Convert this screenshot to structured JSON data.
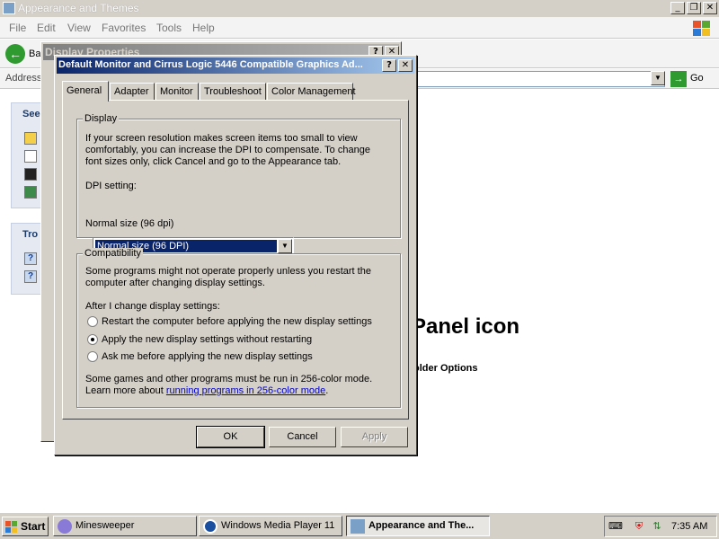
{
  "explorer": {
    "title": "Appearance and Themes",
    "menu": [
      "File",
      "Edit",
      "View",
      "Favorites",
      "Tools",
      "Help"
    ],
    "back_label": "Ba",
    "address_label": "Address",
    "go_label": "Go",
    "see_also_header": "See",
    "troubleshooters_header": "Tro",
    "heading": "Panel icon",
    "folder_options_link": "older Options"
  },
  "display_properties": {
    "title": "Display Properties"
  },
  "dialog": {
    "title": "Default Monitor and Cirrus Logic 5446 Compatible Graphics Ad...",
    "tabs": [
      "General",
      "Adapter",
      "Monitor",
      "Troubleshoot",
      "Color Management"
    ],
    "display_group": {
      "legend": "Display",
      "description": [
        "If your screen resolution makes screen items too small to view",
        "comfortably, you can increase the DPI to compensate.  To change",
        "font sizes only, click Cancel and go to the Appearance tab."
      ],
      "dpi_label": "DPI setting:",
      "dpi_value": "Normal size (96 DPI)",
      "dpi_note": "Normal size (96 dpi)"
    },
    "compat_group": {
      "legend": "Compatibility",
      "description": [
        "Some programs might not operate properly unless you restart the",
        "computer after changing display settings."
      ],
      "after_label": "After I change display settings:",
      "options": [
        "Restart the computer before applying the new display settings",
        "Apply the new display settings without restarting",
        "Ask me before applying the new display settings"
      ],
      "selected_index": 1,
      "games_note": "Some games and other programs must be run in 256-color mode.",
      "learn_more_prefix": "Learn more about ",
      "learn_more_link": "running programs in 256-color mode",
      "learn_more_suffix": "."
    },
    "buttons": {
      "ok": "OK",
      "cancel": "Cancel",
      "apply": "Apply"
    }
  },
  "taskbar": {
    "start_label": "Start",
    "tasks": [
      "Minesweeper",
      "Windows Media Player 11",
      "Appearance and The..."
    ],
    "active_task_index": 2,
    "clock": "7:35 AM"
  },
  "colors": {
    "title_active": "#0a246a",
    "title_gradient_end": "#a6caf0",
    "face": "#d4d0c8",
    "link": "#0000cc"
  }
}
